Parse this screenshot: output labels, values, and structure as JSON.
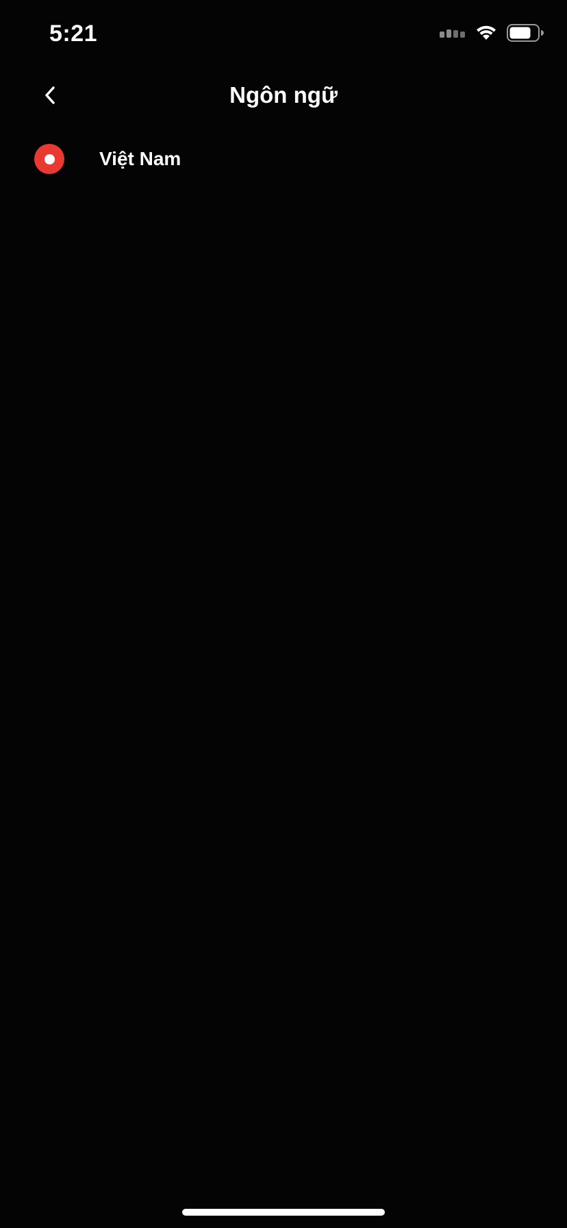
{
  "status_bar": {
    "time": "5:21",
    "icons": [
      "cellular-signal-icon",
      "wifi-icon",
      "battery-icon"
    ]
  },
  "nav": {
    "title": "Ngôn ngữ",
    "back_icon": "chevron-left-icon"
  },
  "languages": [
    {
      "label": "Việt Nam",
      "selected": true
    }
  ],
  "colors": {
    "background": "#040404",
    "accent": "#E83A30",
    "text": "#FFFFFF"
  }
}
